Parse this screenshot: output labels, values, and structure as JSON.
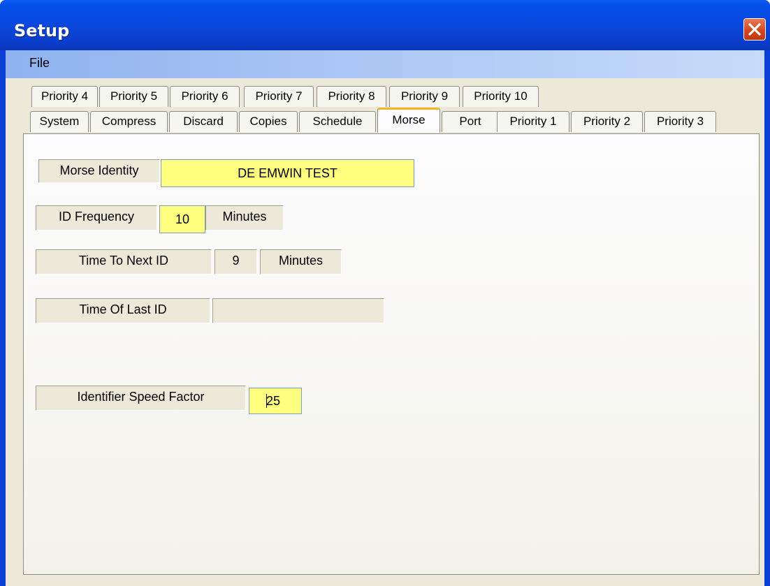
{
  "window": {
    "title": "Setup"
  },
  "menu": {
    "file": "File"
  },
  "tabs": {
    "row1": [
      "Priority 4",
      "Priority 5",
      "Priority 6",
      "Priority 7",
      "Priority 8",
      "Priority 9",
      "Priority 10"
    ],
    "row2": [
      "System",
      "Compress",
      "Discard",
      "Copies",
      "Schedule",
      "Morse",
      "Port",
      "Priority 1",
      "Priority 2",
      "Priority 3"
    ],
    "active": "Morse"
  },
  "morse": {
    "identity_label": "Morse Identity",
    "identity_value": "DE EMWIN TEST",
    "frequency_label": "ID Frequency",
    "frequency_value": "10",
    "frequency_unit": "Minutes",
    "next_id_label": "Time To Next ID",
    "next_id_value": "9",
    "next_id_unit": "Minutes",
    "last_id_label": "Time Of Last ID",
    "last_id_value": "",
    "speed_label": "Identifier Speed Factor",
    "speed_value": "25"
  },
  "colors": {
    "titlebar": "#0a48de",
    "input_background": "#ffff80",
    "active_tab_accent": "#f3b227",
    "close_button": "#d4461e"
  }
}
